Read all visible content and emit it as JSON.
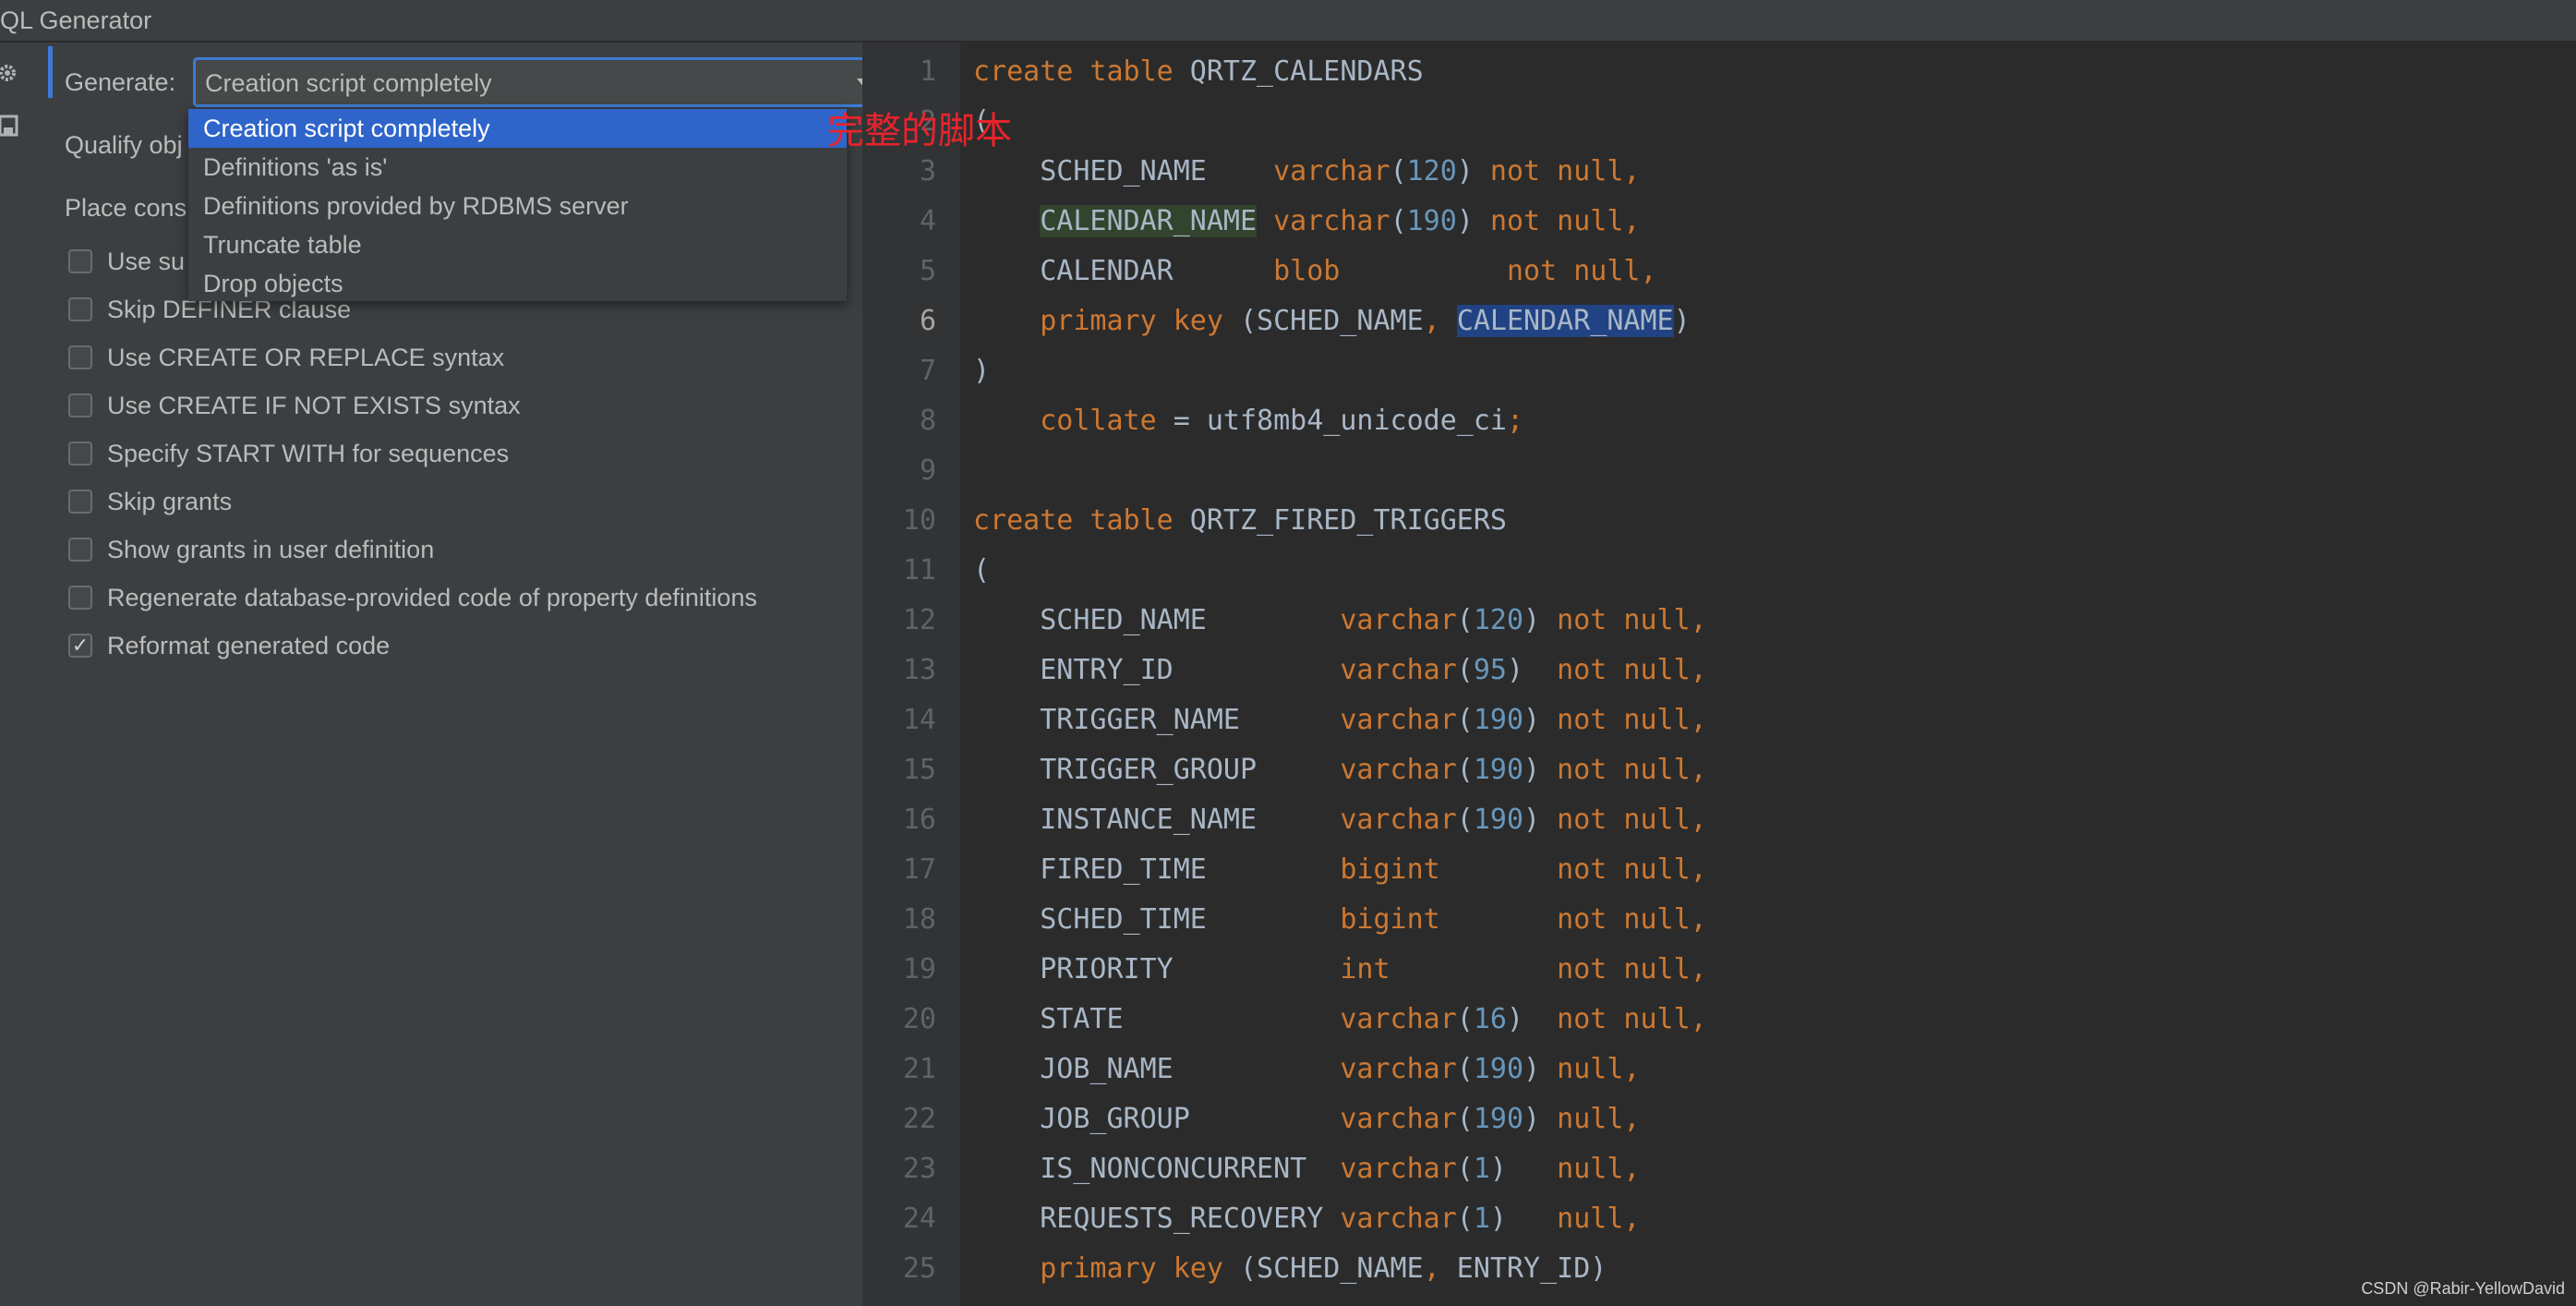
{
  "window": {
    "title": "QL Generator"
  },
  "toolstrip": {
    "icons": [
      "gear-icon",
      "save-icon"
    ]
  },
  "options": {
    "generate_label": "Generate:",
    "generate_value": "Creation script completely",
    "qualify_label": "Qualify obj",
    "place_label": "Place cons",
    "use_sub_label": "Use su",
    "checkboxes": [
      {
        "label": "Skip DEFINER clause",
        "checked": false
      },
      {
        "label": "Use CREATE OR REPLACE syntax",
        "checked": false
      },
      {
        "label": "Use CREATE IF NOT EXISTS syntax",
        "checked": false
      },
      {
        "label": "Specify START WITH for sequences",
        "checked": false
      },
      {
        "label": "Skip grants",
        "checked": false
      },
      {
        "label": "Show grants in user definition",
        "checked": false
      },
      {
        "label": "Regenerate database-provided code of property definitions",
        "checked": false
      },
      {
        "label": "Reformat generated code",
        "checked": true
      }
    ],
    "check_mark": "✓"
  },
  "dropdown": {
    "options": [
      "Creation script completely",
      "Definitions 'as is'",
      "Definitions provided by RDBMS server",
      "Truncate table",
      "Drop objects"
    ],
    "selected_index": 0
  },
  "annotation": "完整的脚本",
  "editor": {
    "line_numbers": [
      "1",
      "2",
      "3",
      "4",
      "5",
      "6",
      "7",
      "8",
      "9",
      "10",
      "11",
      "12",
      "13",
      "14",
      "15",
      "16",
      "17",
      "18",
      "19",
      "20",
      "21",
      "22",
      "23",
      "24",
      "25"
    ],
    "current_line": "6",
    "lines": [
      [
        {
          "t": "create table",
          "c": "kw"
        },
        {
          "t": " QRTZ_CALENDARS"
        }
      ],
      [
        {
          "t": "("
        }
      ],
      [
        {
          "t": "    SCHED_NAME    "
        },
        {
          "t": "varchar",
          "c": "kw"
        },
        {
          "t": "("
        },
        {
          "t": "120",
          "c": "num"
        },
        {
          "t": ") "
        },
        {
          "t": "not null,",
          "c": "kw"
        }
      ],
      [
        {
          "t": "    "
        },
        {
          "t": "CALENDAR_NAME",
          "c": "hl-green"
        },
        {
          "t": " "
        },
        {
          "t": "varchar",
          "c": "kw"
        },
        {
          "t": "("
        },
        {
          "t": "190",
          "c": "num"
        },
        {
          "t": ") "
        },
        {
          "t": "not null,",
          "c": "kw"
        }
      ],
      [
        {
          "t": "    CALENDAR      "
        },
        {
          "t": "blob",
          "c": "kw"
        },
        {
          "t": "          "
        },
        {
          "t": "not null,",
          "c": "kw"
        }
      ],
      [
        {
          "t": "    "
        },
        {
          "t": "primary key",
          "c": "kw"
        },
        {
          "t": " (SCHED_NAME"
        },
        {
          "t": ",",
          "c": "kw"
        },
        {
          "t": " "
        },
        {
          "t": "CALENDAR_NAME",
          "c": "hl-blue"
        },
        {
          "t": ")"
        }
      ],
      [
        {
          "t": ")"
        }
      ],
      [
        {
          "t": "    "
        },
        {
          "t": "collate",
          "c": "kw"
        },
        {
          "t": " = utf8mb4_unicode_ci"
        },
        {
          "t": ";",
          "c": "kw"
        }
      ],
      [
        {
          "t": ""
        }
      ],
      [
        {
          "t": "create table",
          "c": "kw"
        },
        {
          "t": " QRTZ_FIRED_TRIGGERS"
        }
      ],
      [
        {
          "t": "("
        }
      ],
      [
        {
          "t": "    SCHED_NAME        "
        },
        {
          "t": "varchar",
          "c": "kw"
        },
        {
          "t": "("
        },
        {
          "t": "120",
          "c": "num"
        },
        {
          "t": ") "
        },
        {
          "t": "not null,",
          "c": "kw"
        }
      ],
      [
        {
          "t": "    ENTRY_ID          "
        },
        {
          "t": "varchar",
          "c": "kw"
        },
        {
          "t": "("
        },
        {
          "t": "95",
          "c": "num"
        },
        {
          "t": ")  "
        },
        {
          "t": "not null,",
          "c": "kw"
        }
      ],
      [
        {
          "t": "    TRIGGER_NAME      "
        },
        {
          "t": "varchar",
          "c": "kw"
        },
        {
          "t": "("
        },
        {
          "t": "190",
          "c": "num"
        },
        {
          "t": ") "
        },
        {
          "t": "not null,",
          "c": "kw"
        }
      ],
      [
        {
          "t": "    TRIGGER_GROUP     "
        },
        {
          "t": "varchar",
          "c": "kw"
        },
        {
          "t": "("
        },
        {
          "t": "190",
          "c": "num"
        },
        {
          "t": ") "
        },
        {
          "t": "not null,",
          "c": "kw"
        }
      ],
      [
        {
          "t": "    INSTANCE_NAME     "
        },
        {
          "t": "varchar",
          "c": "kw"
        },
        {
          "t": "("
        },
        {
          "t": "190",
          "c": "num"
        },
        {
          "t": ") "
        },
        {
          "t": "not null,",
          "c": "kw"
        }
      ],
      [
        {
          "t": "    FIRED_TIME        "
        },
        {
          "t": "bigint",
          "c": "kw"
        },
        {
          "t": "       "
        },
        {
          "t": "not null,",
          "c": "kw"
        }
      ],
      [
        {
          "t": "    SCHED_TIME        "
        },
        {
          "t": "bigint",
          "c": "kw"
        },
        {
          "t": "       "
        },
        {
          "t": "not null,",
          "c": "kw"
        }
      ],
      [
        {
          "t": "    PRIORITY          "
        },
        {
          "t": "int",
          "c": "kw"
        },
        {
          "t": "          "
        },
        {
          "t": "not null,",
          "c": "kw"
        }
      ],
      [
        {
          "t": "    STATE             "
        },
        {
          "t": "varchar",
          "c": "kw"
        },
        {
          "t": "("
        },
        {
          "t": "16",
          "c": "num"
        },
        {
          "t": ")  "
        },
        {
          "t": "not null,",
          "c": "kw"
        }
      ],
      [
        {
          "t": "    JOB_NAME          "
        },
        {
          "t": "varchar",
          "c": "kw"
        },
        {
          "t": "("
        },
        {
          "t": "190",
          "c": "num"
        },
        {
          "t": ") "
        },
        {
          "t": "null,",
          "c": "kw"
        }
      ],
      [
        {
          "t": "    JOB_GROUP         "
        },
        {
          "t": "varchar",
          "c": "kw"
        },
        {
          "t": "("
        },
        {
          "t": "190",
          "c": "num"
        },
        {
          "t": ") "
        },
        {
          "t": "null,",
          "c": "kw"
        }
      ],
      [
        {
          "t": "    IS_NONCONCURRENT  "
        },
        {
          "t": "varchar",
          "c": "kw"
        },
        {
          "t": "("
        },
        {
          "t": "1",
          "c": "num"
        },
        {
          "t": ")   "
        },
        {
          "t": "null,",
          "c": "kw"
        }
      ],
      [
        {
          "t": "    REQUESTS_RECOVERY "
        },
        {
          "t": "varchar",
          "c": "kw"
        },
        {
          "t": "("
        },
        {
          "t": "1",
          "c": "num"
        },
        {
          "t": ")   "
        },
        {
          "t": "null,",
          "c": "kw"
        }
      ],
      [
        {
          "t": "    "
        },
        {
          "t": "primary key",
          "c": "kw"
        },
        {
          "t": " (SCHED_NAME"
        },
        {
          "t": ",",
          "c": "kw"
        },
        {
          "t": " ENTRY_ID)"
        }
      ]
    ]
  },
  "watermark": "CSDN @Rabir-YellowDavid"
}
